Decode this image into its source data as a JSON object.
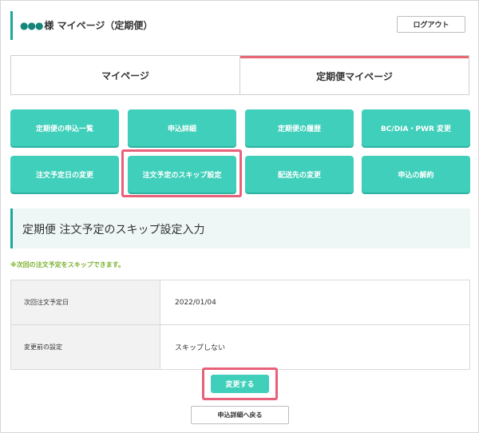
{
  "header": {
    "dots": "●●●",
    "title": "様 マイページ（定期便）",
    "logout_label": "ログアウト"
  },
  "tabs": [
    {
      "label": "マイページ",
      "active": false
    },
    {
      "label": "定期便マイページ",
      "active": true
    }
  ],
  "menu": {
    "row1": [
      "定期便の申込一覧",
      "申込詳細",
      "定期便の履歴",
      "BC/DIA・PWR 変更"
    ],
    "row2": [
      "注文予定日の変更",
      "注文予定のスキップ設定",
      "配送先の変更",
      "申込の解約"
    ],
    "highlighted": "注文予定のスキップ設定"
  },
  "section": {
    "title": "定期便 注文予定のスキップ設定入力",
    "note": "※次回の注文予定をスキップできます。"
  },
  "table": {
    "rows": [
      {
        "label": "次回注文予定日",
        "value": "2022/01/04"
      },
      {
        "label": "変更前の設定",
        "value": "スキップしない"
      }
    ]
  },
  "actions": {
    "submit_label": "変更する",
    "back_label": "申込詳細へ戻る"
  },
  "colors": {
    "accent_teal": "#3fcfbb",
    "header_bar": "#1aa89a",
    "highlight": "#e8607a",
    "note_green": "#7ab02c"
  }
}
